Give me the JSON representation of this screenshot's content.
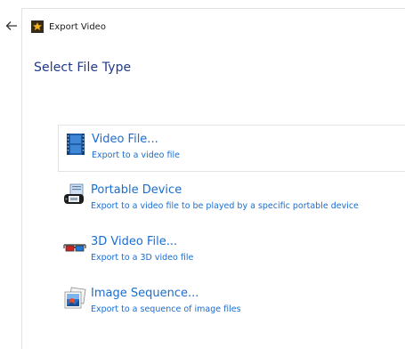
{
  "window": {
    "title": "Export Video",
    "back_icon": "arrow-left-icon",
    "app_icon": "video-app-icon"
  },
  "heading": "Select File Type",
  "options": [
    {
      "label": "Video File...",
      "description": "Export to a video file",
      "icon": "film-strip-icon",
      "selected": true
    },
    {
      "label": "Portable Device",
      "description": "Export to a video file to be played by a specific portable device",
      "icon": "portable-device-icon",
      "selected": false
    },
    {
      "label": "3D Video File...",
      "description": "Export to a 3D video file",
      "icon": "3d-glasses-icon",
      "selected": false
    },
    {
      "label": "Image Sequence...",
      "description": "Export to a sequence of image files",
      "icon": "image-sequence-icon",
      "selected": false
    }
  ],
  "colors": {
    "link_blue": "#1a6dd0",
    "heading_blue": "#1f3a8a",
    "border": "#e3e3e3"
  }
}
